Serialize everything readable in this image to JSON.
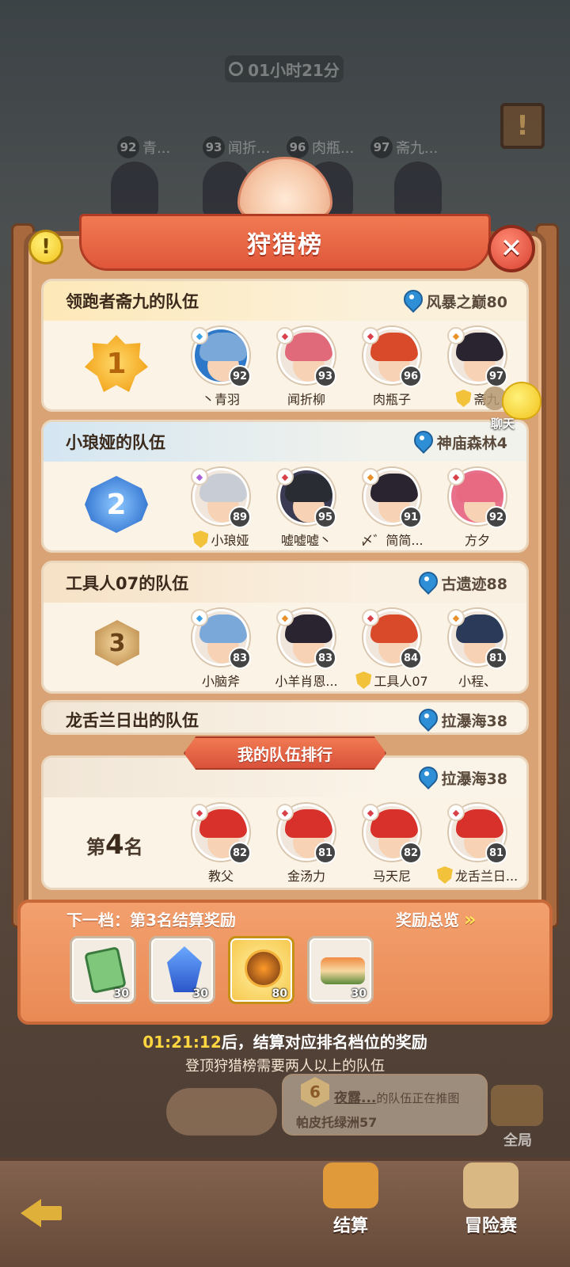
{
  "timer": "01小时21分",
  "background_tags": [
    {
      "level": "92",
      "name": "青..."
    },
    {
      "level": "93",
      "name": "闻折..."
    },
    {
      "level": "96",
      "name": "肉瓶..."
    },
    {
      "level": "97",
      "name": "斋九..."
    }
  ],
  "title": "狩猎榜",
  "teams": [
    {
      "rank": "1",
      "name": "领跑者斋九的队伍",
      "location": "风暴之巅80",
      "members": [
        {
          "name": "丶青羽",
          "level": "92",
          "elem_color": "#3aa0e8",
          "hair": "#7aa8d8",
          "ring": "#2d78c8"
        },
        {
          "name": "闻折柳",
          "level": "93",
          "elem_color": "#d8404a",
          "hair": "#e06a7a",
          "ring": "#f0e6dc"
        },
        {
          "name": "肉瓶子",
          "level": "96",
          "elem_color": "#d8404a",
          "hair": "#d84a2a",
          "ring": "#f0e6dc"
        },
        {
          "name": "斋九",
          "level": "97",
          "elem_color": "#e8902a",
          "hair": "#2a2430",
          "ring": "#f0e6dc",
          "leader": true
        }
      ]
    },
    {
      "rank": "2",
      "name": "小琅娅的队伍",
      "location": "神庙森林4",
      "members": [
        {
          "name": "小琅娅",
          "level": "89",
          "elem_color": "#a860d8",
          "hair": "#c8ccd4",
          "ring": "#f0e6dc",
          "leader": true
        },
        {
          "name": "嘘嘘嘘丶",
          "level": "95",
          "elem_color": "#d8404a",
          "hair": "#2a2c34",
          "ring": "#3a3a52"
        },
        {
          "name": "〆゛简简...",
          "level": "91",
          "elem_color": "#e8902a",
          "hair": "#2a2430",
          "ring": "#f0e6dc"
        },
        {
          "name": "方夕",
          "level": "92",
          "elem_color": "#d8404a",
          "hair": "#e86a82",
          "ring": "#e8708a"
        }
      ]
    },
    {
      "rank": "3",
      "name": "工具人07的队伍",
      "location": "古遗迹88",
      "members": [
        {
          "name": "小脑斧",
          "level": "83",
          "elem_color": "#3aa0e8",
          "hair": "#7aa8d8",
          "ring": "#f0e6dc"
        },
        {
          "name": "小羊肖恩...",
          "level": "83",
          "elem_color": "#e8902a",
          "hair": "#2a2430",
          "ring": "#f0e6dc"
        },
        {
          "name": "工具人07",
          "level": "84",
          "elem_color": "#d8404a",
          "hair": "#d84a2a",
          "ring": "#f0e6dc",
          "leader": true
        },
        {
          "name": "小程、",
          "level": "81",
          "elem_color": "#e8902a",
          "hair": "#2a3a58",
          "ring": "#f0e6dc"
        }
      ]
    }
  ],
  "fourth_team": {
    "name": "龙舌兰日出的队伍",
    "location": "拉瀑海38"
  },
  "my_team": {
    "ribbon": "我的队伍排行",
    "location": "拉瀑海38",
    "rank_prefix": "第",
    "rank": "4",
    "rank_suffix": "名",
    "members": [
      {
        "name": "教父",
        "level": "82",
        "elem_color": "#d8404a",
        "hair": "#d8302a",
        "ring": "#f0e6dc"
      },
      {
        "name": "金汤力",
        "level": "81",
        "elem_color": "#d8404a",
        "hair": "#d8302a",
        "ring": "#f0e6dc"
      },
      {
        "name": "马天尼",
        "level": "82",
        "elem_color": "#d8404a",
        "hair": "#d8302a",
        "ring": "#f0e6dc"
      },
      {
        "name": "龙舌兰日...",
        "level": "81",
        "elem_color": "#d8404a",
        "hair": "#d8302a",
        "ring": "#f0e6dc",
        "leader": true
      }
    ]
  },
  "rewards": {
    "title": "下一档：第3名结算奖励",
    "overview": "奖励总览",
    "items": [
      {
        "icon": "ticket-icon",
        "qty": "30"
      },
      {
        "icon": "crystal-icon",
        "qty": "30"
      },
      {
        "icon": "orb-icon",
        "qty": "80"
      },
      {
        "icon": "food-icon",
        "qty": "30"
      }
    ]
  },
  "countdown_time": "01:21:12",
  "countdown_text": "后，结算对应排名档位的奖励",
  "note": "登顶狩猎榜需要两人以上的队伍",
  "team_banner": {
    "badge": "6",
    "name": "夜露...",
    "text": "的队伍正在推图",
    "location": "帕皮托绿洲57"
  },
  "global_label": "全局",
  "chat_label": "聊天",
  "nav": {
    "settle": "结算",
    "adventure": "冒险赛"
  }
}
